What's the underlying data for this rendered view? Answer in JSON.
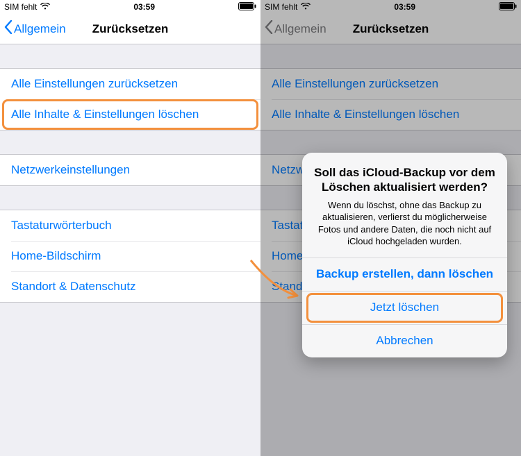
{
  "status": {
    "carrier": "SIM fehlt",
    "time": "03:59"
  },
  "nav": {
    "back": "Allgemein",
    "title": "Zurücksetzen"
  },
  "groups": [
    {
      "rows": [
        "Alle Einstellungen zurücksetzen",
        "Alle Inhalte & Einstellungen löschen"
      ]
    },
    {
      "rows": [
        "Netzwerkeinstellungen"
      ]
    },
    {
      "rows": [
        "Tastaturwörterbuch",
        "Home-Bildschirm",
        "Standort & Datenschutz"
      ]
    }
  ],
  "modal": {
    "title": "Soll das iCloud-Backup vor dem Löschen aktualisiert werden?",
    "message": "Wenn du löschst, ohne das Backup zu aktualisieren, verlierst du möglicherweise Fotos und andere Daten, die noch nicht auf iCloud hochgeladen wurden.",
    "buttons": [
      "Backup erstellen, dann löschen",
      "Jetzt löschen",
      "Abbrechen"
    ]
  },
  "colors": {
    "accent": "#007aff",
    "highlight": "#f3903d"
  }
}
